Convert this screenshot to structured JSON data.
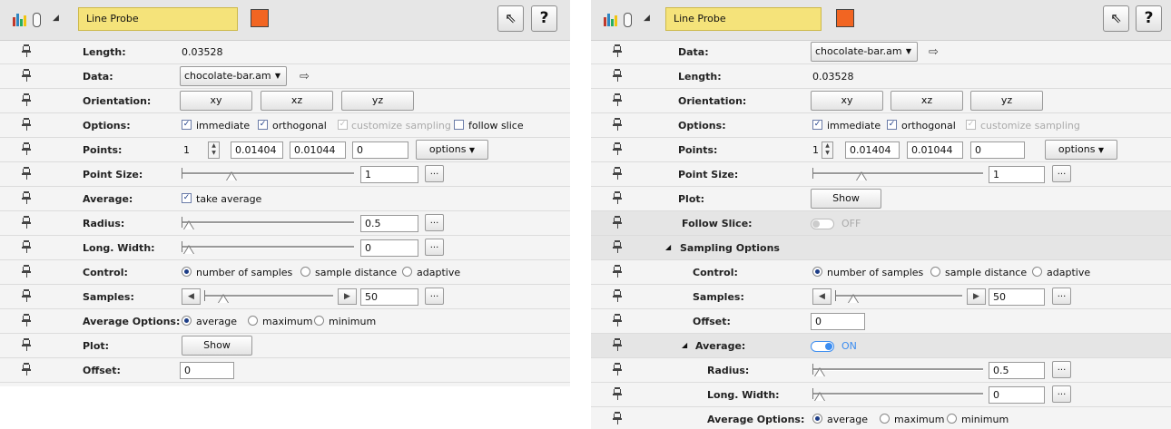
{
  "title": "Line Probe",
  "title_color": "#f26522",
  "icons": {
    "toolbar": [
      "data-icon",
      "clip-icon",
      "collapse-caret-icon",
      "pointer-icon",
      "help-icon"
    ],
    "row_pin": "pin-icon"
  },
  "glyphs": {
    "help": "?",
    "pointer": "⇖",
    "caret": "◢",
    "collapse": "◢",
    "browse": "...",
    "dropdown": "▼",
    "goto": "⇨",
    "step_left": "◀",
    "step_right": "▶",
    "spin_up": "▲",
    "spin_down": "▼",
    "check": "✓"
  },
  "left": {
    "length": {
      "label": "Length:",
      "value": "0.03528"
    },
    "data": {
      "label": "Data:",
      "value": "chocolate-bar.am"
    },
    "orientation": {
      "label": "Orientation:",
      "buttons": [
        "xy",
        "xz",
        "yz"
      ]
    },
    "options": {
      "label": "Options:",
      "items": [
        "immediate",
        "orthogonal",
        "customize sampling",
        "follow slice"
      ]
    },
    "points": {
      "label": "Points:",
      "index": "1",
      "x": "0.01404",
      "y": "0.01044",
      "z": "0",
      "menu": "options"
    },
    "point_size": {
      "label": "Point Size:",
      "value": "1",
      "level": 0.27
    },
    "average": {
      "label": "Average:",
      "checkbox": "take average"
    },
    "radius": {
      "label": "Radius:",
      "value": "0.5",
      "level": 0.0
    },
    "long_width": {
      "label": "Long. Width:",
      "value": "0",
      "level": 0.0
    },
    "control": {
      "label": "Control:",
      "options": [
        "number of samples",
        "sample distance",
        "adaptive"
      ]
    },
    "samples": {
      "label": "Samples:",
      "value": "50",
      "level": 0.1
    },
    "average_options": {
      "label": "Average Options:",
      "options": [
        "average",
        "maximum",
        "minimum"
      ]
    },
    "plot": {
      "label": "Plot:",
      "button": "Show"
    },
    "offset": {
      "label": "Offset:",
      "value": "0"
    }
  },
  "right": {
    "data": {
      "label": "Data:",
      "value": "chocolate-bar.am"
    },
    "length": {
      "label": "Length:",
      "value": "0.03528"
    },
    "orientation": {
      "label": "Orientation:",
      "buttons": [
        "xy",
        "xz",
        "yz"
      ]
    },
    "options": {
      "label": "Options:",
      "items": [
        "immediate",
        "orthogonal",
        "customize sampling"
      ]
    },
    "points": {
      "label": "Points:",
      "index": "1",
      "x": "0.01404",
      "y": "0.01044",
      "z": "0",
      "menu": "options"
    },
    "point_size": {
      "label": "Point Size:",
      "value": "1",
      "level": 0.27
    },
    "plot": {
      "label": "Plot:",
      "button": "Show"
    },
    "follow_slice": {
      "label": "Follow Slice:",
      "state": "OFF"
    },
    "sampling_options": {
      "label": "Sampling Options"
    },
    "control": {
      "label": "Control:",
      "options": [
        "number of samples",
        "sample distance",
        "adaptive"
      ]
    },
    "samples": {
      "label": "Samples:",
      "value": "50",
      "level": 0.1
    },
    "offset": {
      "label": "Offset:",
      "value": "0"
    },
    "average": {
      "label": "Average:",
      "state": "ON"
    },
    "radius": {
      "label": "Radius:",
      "value": "0.5",
      "level": 0.0
    },
    "long_width": {
      "label": "Long. Width:",
      "value": "0",
      "level": 0.0
    },
    "average_options": {
      "label": "Average Options:",
      "options": [
        "average",
        "maximum",
        "minimum"
      ]
    }
  }
}
